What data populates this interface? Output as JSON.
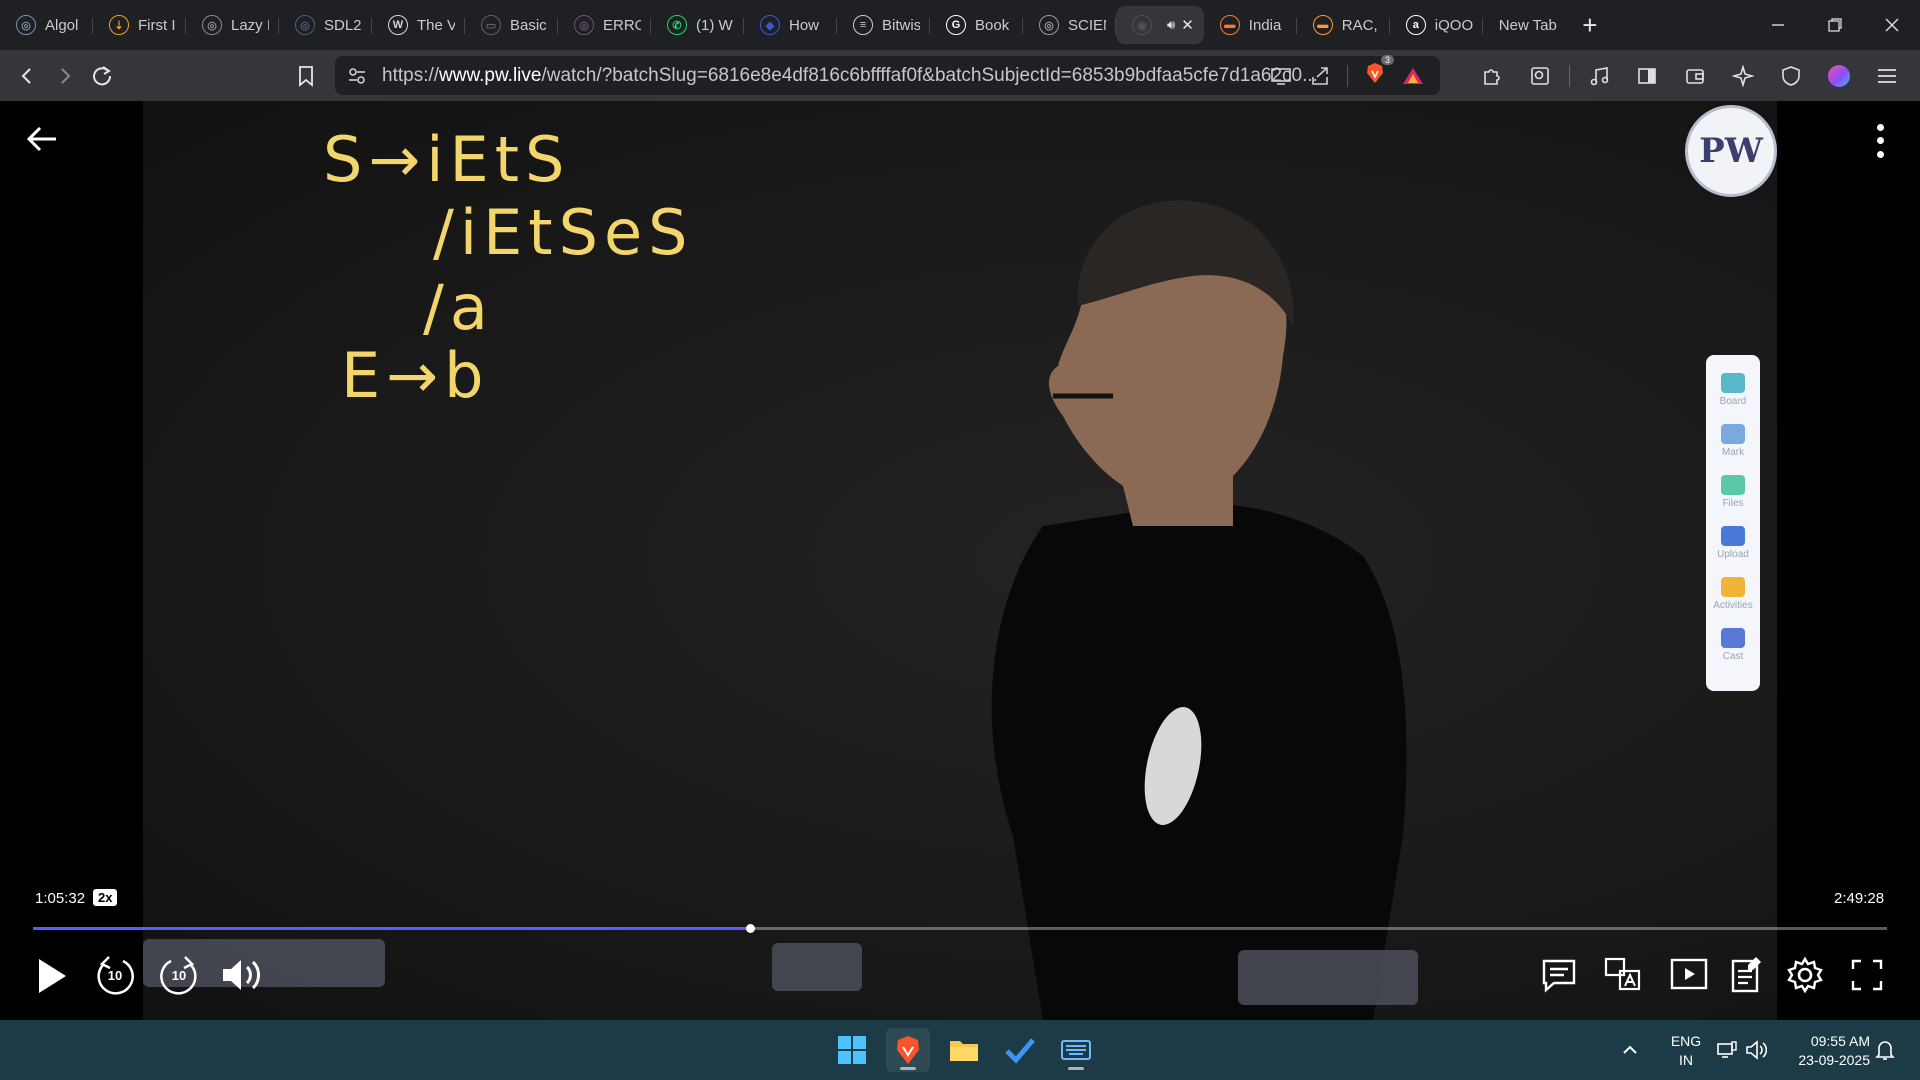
{
  "browser": {
    "tabs": [
      {
        "title": "Algol",
        "icon": "globe-icon",
        "color": "#7a8fa6"
      },
      {
        "title": "First I",
        "icon": "arrow-icon",
        "color": "#f0a020"
      },
      {
        "title": "Lazy I",
        "icon": "globe-icon",
        "color": "#8a8a8a"
      },
      {
        "title": "SDL2",
        "icon": "globe-icon",
        "color": "#4c5e78"
      },
      {
        "title": "The V",
        "icon": "wordpress-icon",
        "color": "#d8d8d8"
      },
      {
        "title": "Basic",
        "icon": "box-icon",
        "color": "#606060"
      },
      {
        "title": "ERRO",
        "icon": "globe-icon",
        "color": "#6f5070"
      },
      {
        "title": "(1) W",
        "icon": "whatsapp-icon",
        "color": "#25d366"
      },
      {
        "title": "How",
        "icon": "shield-icon",
        "color": "#3b57d6"
      },
      {
        "title": "Bitwis",
        "icon": "text-icon",
        "color": "#c9cbd1"
      },
      {
        "title": "Book",
        "icon": "google-icon",
        "color": "#ffffff"
      },
      {
        "title": "SCIEN",
        "icon": "globe-icon",
        "color": "#9a9a9a"
      },
      {
        "title": "",
        "icon": "pw-icon",
        "color": "#505050",
        "active": true
      },
      {
        "title": "India",
        "icon": "flag-icon",
        "color": "#ff7a2a"
      },
      {
        "title": "RAC,",
        "icon": "flag-icon",
        "color": "#ff9933"
      },
      {
        "title": "iQOO",
        "icon": "amazon-icon",
        "color": "#ffffff"
      },
      {
        "title": "New Tab",
        "icon": "",
        "color": ""
      }
    ],
    "url_scheme": "https://",
    "url_host": "www.pw.live",
    "url_path": "/watch/?batchSlug=6816e8e4df816c6bffffaf0f&batchSubjectId=6853b9bdfaa5cfe7d1a62c0...",
    "brave_badge": "3"
  },
  "player": {
    "chalk_lines": [
      "S→iEtS",
      "/iEtSeS",
      "/a",
      "E→b"
    ],
    "logo_text": "PW",
    "board_tools": [
      {
        "label": "Board",
        "icon": "board-icon"
      },
      {
        "label": "Mark",
        "icon": "pen-icon"
      },
      {
        "label": "Files",
        "icon": "folder-icon"
      },
      {
        "label": "Upload",
        "icon": "camera-icon"
      },
      {
        "label": "Activities",
        "icon": "bulb-icon"
      },
      {
        "label": "Cast",
        "icon": "cast-icon"
      }
    ],
    "current_time": "1:05:32",
    "speed": "2x",
    "total_time": "2:49:28",
    "progress_fraction": 0.3866,
    "rewind_seconds": "10",
    "forward_seconds": "10"
  },
  "taskbar": {
    "lang_line1": "ENG",
    "lang_line2": "IN",
    "time": "09:55 AM",
    "date": "23-09-2025"
  },
  "colors": {
    "accent_progress": "#5b5bff",
    "chalk": "#f2d66b",
    "taskbar": "#1c3b47"
  }
}
